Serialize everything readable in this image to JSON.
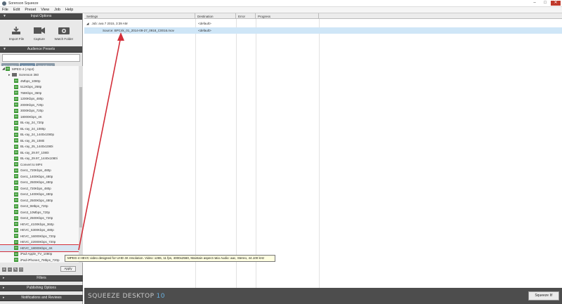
{
  "window": {
    "title": "Sorenson Squeeze"
  },
  "menu": [
    "File",
    "Edit",
    "Preset",
    "View",
    "Job",
    "Help"
  ],
  "input_options": {
    "header": "Input Options",
    "buttons": [
      {
        "label": "Import File",
        "icon": "import-file-icon"
      },
      {
        "label": "Capture",
        "icon": "camera-icon"
      },
      {
        "label": "Watch Folder",
        "icon": "watch-folder-icon"
      }
    ]
  },
  "audience_presets": {
    "header": "Audience Presets",
    "tabs": [
      "Favorites",
      "Formats",
      "Workflows"
    ],
    "active_tab": "Formats"
  },
  "tree": {
    "root": "MPEG-4 (.mp4)",
    "group": "Sorenson 360",
    "items": [
      "4Mbps_1080p",
      "512Kbps_268p",
      "768Kbps_360p",
      "1200Kbps_480p",
      "2000Kbps_720p",
      "3000Kbps_720p",
      "18000Kbps_4K",
      "BL-ray_24_720p",
      "BL-ray_24_1080p",
      "BL-ray_24_1440x1080p",
      "BL-ray_25_1080i",
      "BL-ray_25_1440x1080i",
      "BL-ray_29.97_1080i",
      "BL-ray_29.97_1440x1080i",
      "Convert to MP4",
      "Gen1_720Kbps_480p",
      "Gen1_1400Kbps_480p",
      "Gen1_2500Kbps_480p",
      "Gen2_720Kbps_480p",
      "Gen2_1400Kbps_480p",
      "Gen2_2500Kbps_480p",
      "Gen3_5Mbps_720p",
      "Gen3_10Mbps_720p",
      "Gen3_2500Kbps_720p",
      "HEVC_4100Kbps_360p",
      "HEVC_6300Kbps_480p",
      "HEVC_16000Kbps_720p",
      "HEVC_22000Kbps_720p",
      "HEVC_18000Kbps_4K",
      "iPad-Apple_TV_1080p",
      "iPad-iPhone4_7Mbps_720p"
    ],
    "selected_index": 28
  },
  "tooltip": "MPEG-4 HEVC video designed for UHD 4K resolution. Video: x265, 11 fps, 4000x2560, Maintain aspect ratio Audio: aac, Stereo, 44.100 kHz",
  "apply_label": "Apply",
  "bottom_sections": [
    "Filters",
    "Publishing Options",
    "Notifications and Reviews"
  ],
  "columns": [
    "Settings",
    "Destination",
    "Error",
    "Progress"
  ],
  "job": {
    "label": "Job: ava 7 2015, 3:39 AM",
    "destination": "<default>"
  },
  "source": {
    "label": "Source: BPC4k_01_2014-09-27_0918_C0016.mov",
    "destination": "<default>"
  },
  "footer": {
    "brand": "SQUEEZE DESKTOP",
    "version": "10",
    "squeeze_button": "Squeeze It!"
  }
}
